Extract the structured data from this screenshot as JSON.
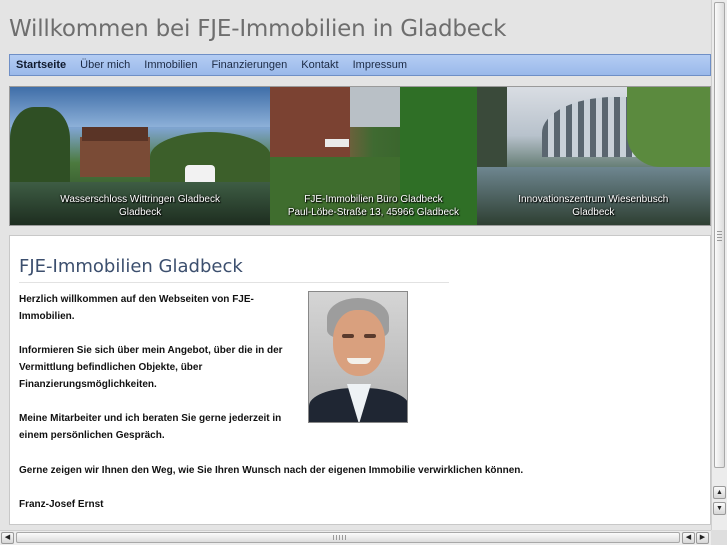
{
  "site": {
    "title": "Willkommen bei FJE-Immobilien in Gladbeck"
  },
  "nav": {
    "items": [
      {
        "label": "Startseite",
        "active": true
      },
      {
        "label": "Über mich"
      },
      {
        "label": "Immobilien"
      },
      {
        "label": "Finanzierungen"
      },
      {
        "label": "Kontakt"
      },
      {
        "label": "Impressum"
      }
    ]
  },
  "banner": {
    "panels": [
      {
        "caption_line1": "Wasserschloss Wittringen Gladbeck",
        "caption_line2": "Gladbeck"
      },
      {
        "caption_line1": "FJE-Immobilien Büro Gladbeck",
        "caption_line2": "Paul-Löbe-Straße 13, 45966 Gladbeck"
      },
      {
        "caption_line1": "Innovationszentrum Wiesenbusch",
        "caption_line2": "Gladbeck"
      }
    ]
  },
  "content": {
    "title": "FJE-Immobilien Gladbeck",
    "paragraphs": {
      "p1_line1": "Herzlich willkommen auf den Webseiten von FJE-",
      "p1_line2": "Immobilien.",
      "p2_line1": "Informieren Sie sich über mein Angebot, über die in der",
      "p2_line2": "Vermittlung befindlichen Objekte, über",
      "p2_line3": "Finanzierungsmöglichkeiten.",
      "p3_line1": "Meine Mitarbeiter und ich beraten Sie gerne jederzeit in",
      "p3_line2": "einem persönlichen Gespräch.",
      "p4": "Gerne zeigen wir Ihnen den Weg, wie Sie Ihren Wunsch nach der eigenen Immobilie verwirklichen können.",
      "signature": "Franz-Josef Ernst"
    }
  },
  "colors": {
    "nav_bg": "#a8c4ee",
    "title_text": "#6e6e6e",
    "heading_text": "#3c4f6e"
  },
  "icons": {
    "scroll_up": "triangle-up",
    "scroll_down": "triangle-down",
    "scroll_left": "triangle-left",
    "scroll_right": "triangle-right"
  }
}
